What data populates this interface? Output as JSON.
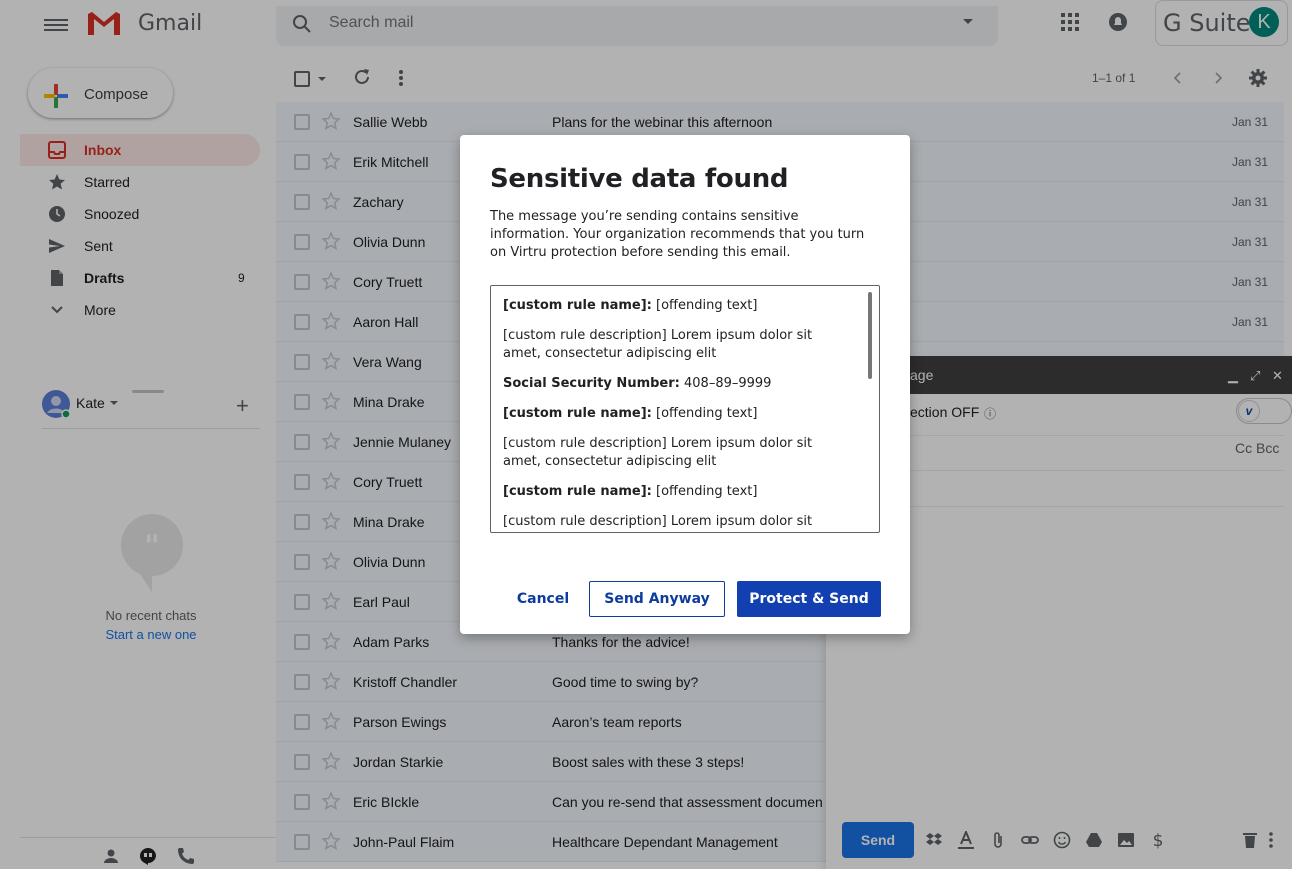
{
  "header": {
    "app_name": "Gmail",
    "search_placeholder": "Search mail",
    "gsuite_label": "G Suite",
    "account_initial": "K"
  },
  "sidebar": {
    "compose_label": "Compose",
    "items": [
      {
        "label": "Inbox",
        "icon": "inbox-icon",
        "active": true
      },
      {
        "label": "Starred",
        "icon": "star-icon"
      },
      {
        "label": "Snoozed",
        "icon": "clock-icon"
      },
      {
        "label": "Sent",
        "icon": "send-icon"
      },
      {
        "label": "Drafts",
        "icon": "draft-icon",
        "count": "9"
      },
      {
        "label": "More",
        "icon": "chevron-down-icon"
      }
    ],
    "hangouts": {
      "user": "Kate",
      "no_chats": "No recent chats",
      "start_chat": "Start a new one"
    }
  },
  "list": {
    "page_count": "1–1 of 1",
    "rows": [
      {
        "sender": "Sallie Webb",
        "subject": "Plans for the webinar this afternoon",
        "date": "Jan 31"
      },
      {
        "sender": "Erik Mitchell",
        "subject": "",
        "date": "Jan 31"
      },
      {
        "sender": "Zachary",
        "subject": "",
        "date": "Jan 31"
      },
      {
        "sender": "Olivia Dunn",
        "subject": "",
        "date": "Jan 31"
      },
      {
        "sender": "Cory Truett",
        "subject": "",
        "date": "Jan 31"
      },
      {
        "sender": "Aaron Hall",
        "subject": "",
        "date": "Jan 31"
      },
      {
        "sender": "Vera Wang",
        "subject": "",
        "date": ""
      },
      {
        "sender": "Mina Drake",
        "subject": "",
        "date": ""
      },
      {
        "sender": "Jennie Mulaney",
        "subject": "",
        "date": ""
      },
      {
        "sender": "Cory Truett",
        "subject": "",
        "date": ""
      },
      {
        "sender": "Mina Drake",
        "subject": "",
        "date": ""
      },
      {
        "sender": "Olivia Dunn",
        "subject": "",
        "date": ""
      },
      {
        "sender": "Earl Paul",
        "subject": "",
        "date": ""
      },
      {
        "sender": "Adam Parks",
        "subject": "Thanks for the advice!",
        "date": ""
      },
      {
        "sender": "Kristoff Chandler",
        "subject": "Good time to swing by?",
        "date": ""
      },
      {
        "sender": "Parson Ewings",
        "subject": "Aaron’s team reports",
        "date": ""
      },
      {
        "sender": "Jordan Starkie",
        "subject": "Boost sales with these 3 steps!",
        "date": ""
      },
      {
        "sender": "Eric BIckle",
        "subject": "Can you re-send that assessment documen",
        "date": ""
      },
      {
        "sender": "John-Paul Flaim",
        "subject": "Healthcare Dependant Management",
        "date": ""
      }
    ]
  },
  "compose_window": {
    "title_fragment": "age",
    "protection_fragment": "ection OFF",
    "toggle_glyph": "v",
    "cc_bcc": "Cc Bcc",
    "send_label": "Send"
  },
  "modal": {
    "title": "Sensitive data found",
    "description": "The message you’re sending contains sensitive information. Your organization recommends that you turn on Virtru protection before sending this email.",
    "findings": [
      {
        "name": "[custom rule name]:",
        "value": "[offending text]"
      },
      {
        "text": "[custom rule description] Lorem ipsum dolor sit amet, consectetur adipiscing elit"
      },
      {
        "name": "Social Security Number:",
        "value": "408–89–9999"
      },
      {
        "name": "[custom rule name]:",
        "value": "[offending text]"
      },
      {
        "text": "[custom rule description] Lorem ipsum dolor sit amet, consectetur adipiscing elit"
      },
      {
        "name": "[custom rule name]:",
        "value": "[offending text]"
      },
      {
        "text": "[custom rule description] Lorem ipsum dolor sit amet,"
      }
    ],
    "cancel_label": "Cancel",
    "send_anyway_label": "Send Anyway",
    "protect_label": "Protect & Send"
  },
  "colors": {
    "brand_blue": "#1340b1",
    "inbox_red": "#d93025",
    "row_bg": "#f2f6fc"
  }
}
